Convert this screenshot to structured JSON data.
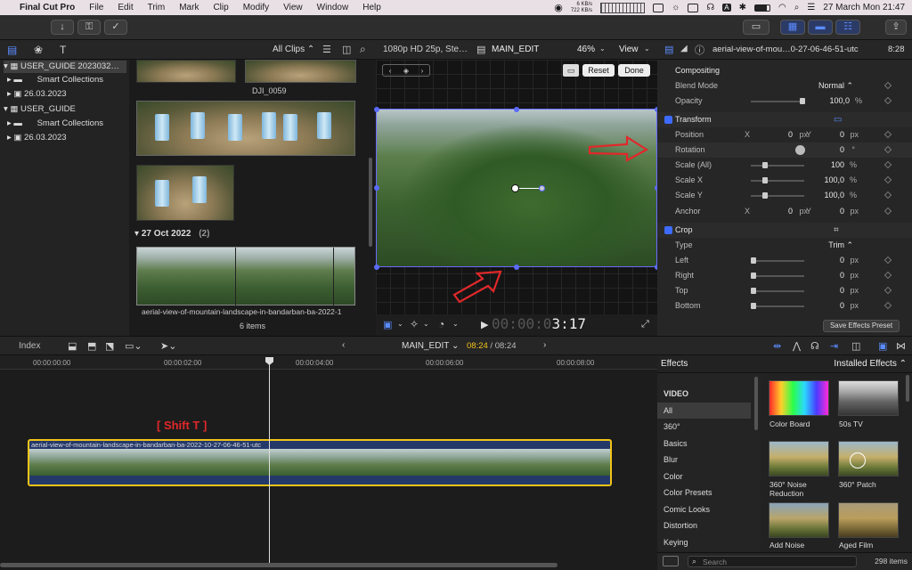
{
  "menubar": {
    "app_name": "Final Cut Pro",
    "menus": [
      "File",
      "Edit",
      "Trim",
      "Mark",
      "Clip",
      "Modify",
      "View",
      "Window",
      "Help"
    ],
    "net_up": "6 KB/s",
    "net_down": "722 KB/s",
    "datetime": "27 March Mon  21:47"
  },
  "browser": {
    "filter": "All Clips ⌃",
    "libraries": [
      {
        "label": "USER_GUIDE 2023032…",
        "level": 0,
        "selected": true
      },
      {
        "label": "Smart Collections",
        "level": 1
      },
      {
        "label": "26.03.2023",
        "level": 1
      },
      {
        "label": "USER_GUIDE",
        "level": 0
      },
      {
        "label": "Smart Collections",
        "level": 1
      },
      {
        "label": "26.03.2023",
        "level": 1
      }
    ],
    "clip_dji": "DJI_0059",
    "date_group": "27 Oct 2022",
    "date_group_count": "(2)",
    "clip_aerial": "aerial-view-of-mountain-landscape-in-bandarban-ba-2022-1",
    "items": "6 items"
  },
  "viewer": {
    "format": "1080p HD 25p, Ste…",
    "project": "MAIN_EDIT",
    "zoom": "46%",
    "view": "View",
    "reset": "Reset",
    "done": "Done",
    "timecode_dim": "00:00:0",
    "timecode": "3:17"
  },
  "inspector": {
    "clip_name": "aerial-view-of-mou…0-27-06-46-51-utc",
    "duration": "8:28",
    "compositing": "Compositing",
    "blend_mode_label": "Blend Mode",
    "blend_mode": "Normal ⌃",
    "opacity_label": "Opacity",
    "opacity": "100,0",
    "opacity_unit": "%",
    "transform": "Transform",
    "position_label": "Position",
    "pos_x_label": "X",
    "pos_x": "0",
    "pos_x_unit": "px",
    "pos_y_label": "Y",
    "pos_y": "0",
    "pos_y_unit": "px",
    "rotation_label": "Rotation",
    "rotation": "0",
    "rotation_unit": "°",
    "scale_all_label": "Scale (All)",
    "scale_all": "100",
    "scale_all_unit": "%",
    "scale_x_label": "Scale X",
    "scale_x": "100,0",
    "scale_x_unit": "%",
    "scale_y_label": "Scale Y",
    "scale_y": "100,0",
    "scale_y_unit": "%",
    "anchor_label": "Anchor",
    "anc_x_label": "X",
    "anc_x": "0",
    "anc_x_unit": "px",
    "anc_y_label": "Y",
    "anc_y": "0",
    "anc_y_unit": "px",
    "crop": "Crop",
    "type_label": "Type",
    "type": "Trim ⌃",
    "left_label": "Left",
    "left": "0",
    "left_unit": "px",
    "right_label": "Right",
    "right": "0",
    "right_unit": "px",
    "top_label": "Top",
    "top": "0",
    "top_unit": "px",
    "bottom_label": "Bottom",
    "bottom": "0",
    "bottom_unit": "px",
    "save_preset": "Save Effects Preset"
  },
  "timeline": {
    "index": "Index",
    "project": "MAIN_EDIT ⌄",
    "duration_current": "08:24",
    "duration_sep": " / 08:24",
    "ticks": [
      "00:00:00:00",
      "00:00:02:00",
      "00:00:04:00",
      "00:00:06:00",
      "00:00:08:00"
    ],
    "annotation": "[ Shift T ]",
    "clip_name": "aerial-view-of-mountain-landscape-in-bandarban-ba-2022-10-27-06-46-51-utc"
  },
  "effects": {
    "title": "Effects",
    "installed": "Installed Effects ⌃",
    "video_header": "VIDEO",
    "categories": [
      "All",
      "360°",
      "Basics",
      "Blur",
      "Color",
      "Color Presets",
      "Comic Looks",
      "Distortion",
      "Keying"
    ],
    "items": [
      "Color Board",
      "50s TV",
      "360° Noise Reduction",
      "360° Patch",
      "Add Noise",
      "Aged Film"
    ],
    "search_placeholder": "Search",
    "count": "298 items"
  },
  "colors": {
    "accent": "#3d6bff",
    "selection_yellow": "#f2c318",
    "annotation_red": "#e0282a"
  }
}
